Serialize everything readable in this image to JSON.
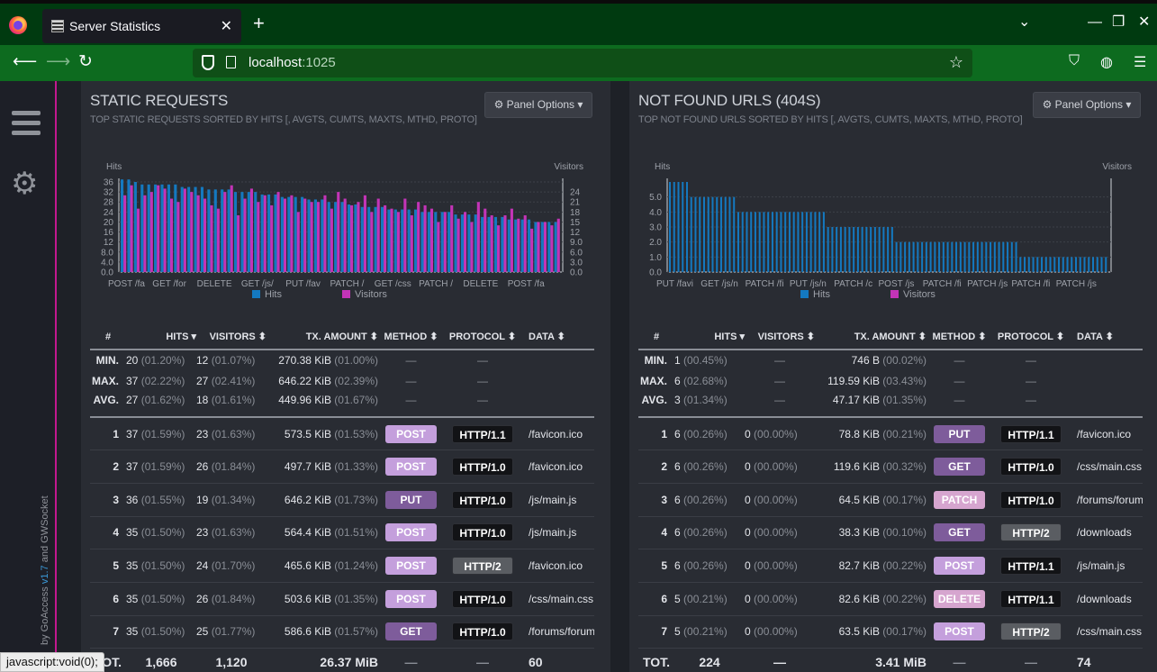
{
  "browser": {
    "tab_title": "Server Statistics",
    "tab_close": "✕",
    "new_tab": "+",
    "url_host": "localhost",
    "url_port": ":1025",
    "window_controls": [
      "⌄",
      "—",
      "❐",
      "✕"
    ]
  },
  "sidebar": {
    "credit_by": "by GoAccess",
    "credit_version": "v1.7",
    "credit_and": "and GWSocket"
  },
  "status_bar": "javascript:void(0);",
  "colors": {
    "hits": "#1479c0",
    "visitors": "#c334b7",
    "accent": "#c2188f"
  },
  "panels": [
    {
      "id": "static",
      "title": "STATIC REQUESTS",
      "subtitle": "TOP STATIC REQUESTS SORTED BY HITS [, AVGTS, CUMTS, MAXTS, MTHD, PROTO]",
      "options_label": "⚙ Panel Options ▾",
      "chart_data": {
        "type": "bar",
        "ylabel_left": "Hits",
        "ylabel_right": "Visitors",
        "left_ticks": [
          "36",
          "32",
          "28",
          "24",
          "20",
          "16",
          "12",
          "8.0",
          "4.0",
          "0.0"
        ],
        "right_ticks": [
          "24",
          "21",
          "18",
          "15",
          "12",
          "9.0",
          "6.0",
          "3.0",
          "0.0"
        ],
        "ylim_left": [
          0,
          36
        ],
        "ylim_right": [
          0,
          27
        ],
        "x_tick_labels": [
          "POST /fa",
          "GET /for",
          "DELETE",
          "GET /js/",
          "PUT /fav",
          "PATCH /",
          "GET /css",
          "PATCH /",
          "DELETE",
          "POST /fa"
        ],
        "legend": [
          "Hits",
          "Visitors"
        ],
        "series": [
          {
            "name": "Hits",
            "values": [
              37,
              37,
              36,
              35,
              35,
              35,
              35,
              35,
              35,
              34,
              34,
              34,
              34,
              33,
              33,
              33,
              33,
              32,
              32,
              32,
              32,
              31,
              31,
              31,
              30,
              30,
              30,
              30,
              29,
              29,
              29,
              28,
              28,
              28,
              27,
              27,
              26,
              26,
              26,
              26,
              25,
              25,
              25,
              25,
              25,
              24,
              24,
              24,
              24,
              24,
              23,
              23,
              23,
              23,
              22,
              22,
              22,
              22,
              21,
              21,
              21,
              21,
              20,
              20,
              20,
              20
            ]
          },
          {
            "name": "Visitors",
            "values": [
              23,
              26,
              19,
              23,
              24,
              26,
              25,
              22,
              21,
              25,
              24,
              23,
              22,
              20,
              19,
              24,
              26,
              17,
              22,
              25,
              21,
              23,
              20,
              24,
              22,
              23,
              18,
              22,
              21,
              21,
              23,
              19,
              24,
              22,
              20,
              21,
              23,
              18,
              22,
              20,
              19,
              18,
              22,
              17,
              21,
              20,
              19,
              15,
              18,
              20,
              16,
              18,
              15,
              21,
              19,
              17,
              14,
              17,
              19,
              16,
              17,
              13,
              15,
              15,
              14,
              16
            ]
          }
        ]
      },
      "table": {
        "headers": [
          "#",
          "HITS ▾",
          "VISITORS ⬍",
          "TX. AMOUNT ⬍",
          "METHOD ⬍",
          "PROTOCOL ⬍",
          "DATA ⬍"
        ],
        "aggregates": [
          {
            "label": "MIN.",
            "hits": "20",
            "hits_pct": "(01.20%)",
            "visitors": "12",
            "visitors_pct": "(01.07%)",
            "tx": "270.38 KiB",
            "tx_pct": "(01.00%)"
          },
          {
            "label": "MAX.",
            "hits": "37",
            "hits_pct": "(02.22%)",
            "visitors": "27",
            "visitors_pct": "(02.41%)",
            "tx": "646.22 KiB",
            "tx_pct": "(02.39%)"
          },
          {
            "label": "AVG.",
            "hits": "27",
            "hits_pct": "(01.62%)",
            "visitors": "18",
            "visitors_pct": "(01.61%)",
            "tx": "449.96 KiB",
            "tx_pct": "(01.67%)"
          }
        ],
        "dash": "—",
        "rows": [
          {
            "n": "1",
            "hits": "37",
            "hits_pct": "(01.59%)",
            "visitors": "23",
            "visitors_pct": "(01.63%)",
            "tx": "573.5 KiB",
            "tx_pct": "(01.53%)",
            "method": "POST",
            "protocol": "HTTP/1.1",
            "data": "/favicon.ico"
          },
          {
            "n": "2",
            "hits": "37",
            "hits_pct": "(01.59%)",
            "visitors": "26",
            "visitors_pct": "(01.84%)",
            "tx": "497.7 KiB",
            "tx_pct": "(01.33%)",
            "method": "POST",
            "protocol": "HTTP/1.0",
            "data": "/favicon.ico"
          },
          {
            "n": "3",
            "hits": "36",
            "hits_pct": "(01.55%)",
            "visitors": "19",
            "visitors_pct": "(01.34%)",
            "tx": "646.2 KiB",
            "tx_pct": "(01.73%)",
            "method": "PUT",
            "protocol": "HTTP/1.0",
            "data": "/js/main.js"
          },
          {
            "n": "4",
            "hits": "35",
            "hits_pct": "(01.50%)",
            "visitors": "23",
            "visitors_pct": "(01.63%)",
            "tx": "564.4 KiB",
            "tx_pct": "(01.51%)",
            "method": "POST",
            "protocol": "HTTP/1.0",
            "data": "/js/main.js"
          },
          {
            "n": "5",
            "hits": "35",
            "hits_pct": "(01.50%)",
            "visitors": "24",
            "visitors_pct": "(01.70%)",
            "tx": "465.6 KiB",
            "tx_pct": "(01.24%)",
            "method": "POST",
            "protocol": "HTTP/2",
            "data": "/favicon.ico"
          },
          {
            "n": "6",
            "hits": "35",
            "hits_pct": "(01.50%)",
            "visitors": "26",
            "visitors_pct": "(01.84%)",
            "tx": "503.6 KiB",
            "tx_pct": "(01.35%)",
            "method": "POST",
            "protocol": "HTTP/1.0",
            "data": "/css/main.css"
          },
          {
            "n": "7",
            "hits": "35",
            "hits_pct": "(01.50%)",
            "visitors": "25",
            "visitors_pct": "(01.77%)",
            "tx": "586.6 KiB",
            "tx_pct": "(01.57%)",
            "method": "GET",
            "protocol": "HTTP/1.0",
            "data": "/forums/forum"
          }
        ],
        "total": {
          "label": "TOT.",
          "hits": "1,666",
          "visitors": "1,120",
          "tx": "26.37 MiB",
          "method": "—",
          "protocol": "—",
          "data": "60"
        }
      }
    },
    {
      "id": "notfound",
      "title": "NOT FOUND URLS (404S)",
      "subtitle": "TOP NOT FOUND URLS SORTED BY HITS [, AVGTS, CUMTS, MAXTS, MTHD, PROTO]",
      "options_label": "⚙ Panel Options ▾",
      "chart_data": {
        "type": "bar",
        "ylabel_left": "Hits",
        "ylabel_right": "Visitors",
        "left_ticks": [
          "5.0",
          "4.0",
          "3.0",
          "2.0",
          "1.0",
          "0.0"
        ],
        "right_ticks": [],
        "ylim_left": [
          0,
          6
        ],
        "x_tick_labels": [
          "PUT /favi",
          "GET /js/n",
          "PATCH /fi",
          "PUT /js/n",
          "PATCH /c",
          "POST /js",
          "PATCH /fi",
          "PATCH /js",
          "PATCH /fi",
          "PATCH /js"
        ],
        "legend": [
          "Hits",
          "Visitors"
        ],
        "series": [
          {
            "name": "Hits",
            "values": [
              6,
              6,
              6,
              6,
              6,
              5,
              5,
              5,
              5,
              5,
              5,
              5,
              5,
              5,
              5,
              5,
              4,
              4,
              4,
              4,
              4,
              4,
              4,
              4,
              4,
              4,
              4,
              4,
              4,
              4,
              4,
              4,
              4,
              4,
              4,
              4,
              4,
              3,
              3,
              3,
              3,
              3,
              3,
              3,
              3,
              3,
              3,
              3,
              3,
              3,
              3,
              3,
              3,
              2,
              2,
              2,
              2,
              2,
              2,
              2,
              2,
              2,
              2,
              2,
              2,
              2,
              2,
              2,
              2,
              2,
              2,
              2,
              2,
              2,
              2,
              2,
              2,
              2,
              2,
              2,
              2,
              2,
              1,
              1,
              1,
              1,
              1,
              1,
              1,
              1,
              1,
              1,
              1,
              1,
              1,
              1,
              1,
              1,
              1,
              1,
              1,
              1,
              1
            ]
          },
          {
            "name": "Visitors",
            "values": [
              0,
              0,
              0,
              0,
              0,
              0,
              0,
              0,
              0,
              0,
              0,
              0,
              0,
              0,
              0,
              0,
              0,
              0,
              0,
              0,
              0,
              0,
              0,
              0,
              0,
              0,
              0,
              0,
              0,
              0,
              0,
              0,
              0,
              0,
              0,
              0,
              0,
              0,
              0,
              0,
              0,
              0,
              0,
              0,
              0,
              0,
              0,
              0,
              0,
              0,
              0,
              0,
              0,
              0,
              0,
              0,
              0,
              0,
              0,
              0,
              0,
              0,
              0,
              0,
              0,
              0,
              0,
              0,
              0,
              0,
              0,
              0,
              0,
              0,
              0,
              0,
              0,
              0,
              0,
              0,
              0,
              0,
              0,
              0,
              0,
              0,
              0,
              0,
              0,
              0,
              0,
              0,
              0,
              0,
              0,
              0,
              0,
              0,
              0,
              0,
              0,
              0,
              0
            ]
          }
        ]
      },
      "table": {
        "headers": [
          "#",
          "HITS ▾",
          "VISITORS ⬍",
          "TX. AMOUNT ⬍",
          "METHOD ⬍",
          "PROTOCOL ⬍",
          "DATA ⬍"
        ],
        "aggregates": [
          {
            "label": "MIN.",
            "hits": "1",
            "hits_pct": "(00.45%)",
            "visitors": "—",
            "visitors_pct": "",
            "tx": "746 B",
            "tx_pct": "(00.02%)"
          },
          {
            "label": "MAX.",
            "hits": "6",
            "hits_pct": "(02.68%)",
            "visitors": "—",
            "visitors_pct": "",
            "tx": "119.59 KiB",
            "tx_pct": "(03.43%)"
          },
          {
            "label": "AVG.",
            "hits": "3",
            "hits_pct": "(01.34%)",
            "visitors": "—",
            "visitors_pct": "",
            "tx": "47.17 KiB",
            "tx_pct": "(01.35%)"
          }
        ],
        "dash": "—",
        "rows": [
          {
            "n": "1",
            "hits": "6",
            "hits_pct": "(00.26%)",
            "visitors": "0",
            "visitors_pct": "(00.00%)",
            "tx": "78.8 KiB",
            "tx_pct": "(00.21%)",
            "method": "PUT",
            "protocol": "HTTP/1.1",
            "data": "/favicon.ico"
          },
          {
            "n": "2",
            "hits": "6",
            "hits_pct": "(00.26%)",
            "visitors": "0",
            "visitors_pct": "(00.00%)",
            "tx": "119.6 KiB",
            "tx_pct": "(00.32%)",
            "method": "GET",
            "protocol": "HTTP/1.0",
            "data": "/css/main.css"
          },
          {
            "n": "3",
            "hits": "6",
            "hits_pct": "(00.26%)",
            "visitors": "0",
            "visitors_pct": "(00.00%)",
            "tx": "64.5 KiB",
            "tx_pct": "(00.17%)",
            "method": "PATCH",
            "protocol": "HTTP/1.0",
            "data": "/forums/forum"
          },
          {
            "n": "4",
            "hits": "6",
            "hits_pct": "(00.26%)",
            "visitors": "0",
            "visitors_pct": "(00.00%)",
            "tx": "38.3 KiB",
            "tx_pct": "(00.10%)",
            "method": "GET",
            "protocol": "HTTP/2",
            "data": "/downloads"
          },
          {
            "n": "5",
            "hits": "6",
            "hits_pct": "(00.26%)",
            "visitors": "0",
            "visitors_pct": "(00.00%)",
            "tx": "82.7 KiB",
            "tx_pct": "(00.22%)",
            "method": "POST",
            "protocol": "HTTP/1.1",
            "data": "/js/main.js"
          },
          {
            "n": "6",
            "hits": "5",
            "hits_pct": "(00.21%)",
            "visitors": "0",
            "visitors_pct": "(00.00%)",
            "tx": "82.6 KiB",
            "tx_pct": "(00.22%)",
            "method": "DELETE",
            "protocol": "HTTP/1.1",
            "data": "/downloads"
          },
          {
            "n": "7",
            "hits": "5",
            "hits_pct": "(00.21%)",
            "visitors": "0",
            "visitors_pct": "(00.00%)",
            "tx": "63.5 KiB",
            "tx_pct": "(00.17%)",
            "method": "POST",
            "protocol": "HTTP/2",
            "data": "/css/main.css"
          }
        ],
        "total": {
          "label": "TOT.",
          "hits": "224",
          "visitors": "—",
          "tx": "3.41 MiB",
          "method": "—",
          "protocol": "—",
          "data": "74"
        }
      }
    }
  ]
}
